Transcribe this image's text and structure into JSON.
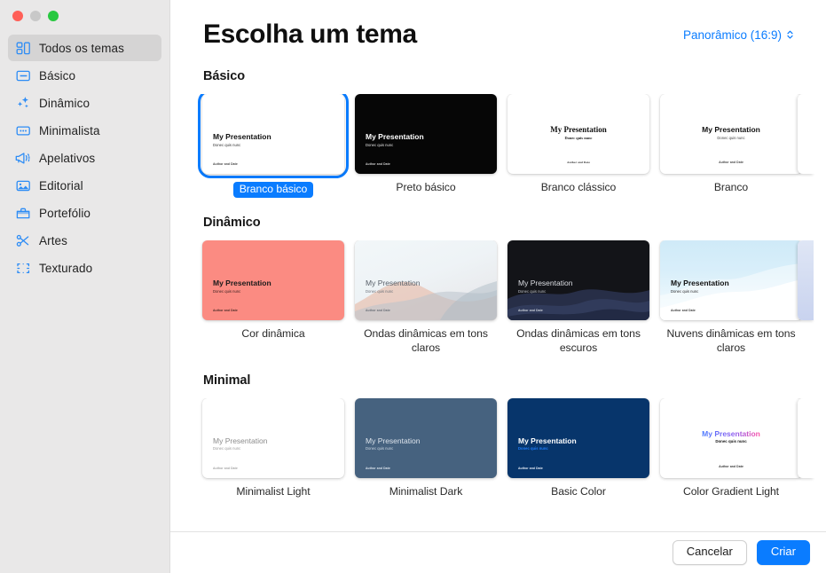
{
  "window": {
    "traffic_lights": [
      "close",
      "minimize",
      "zoom"
    ]
  },
  "sidebar": {
    "items": [
      {
        "label": "Todos os temas",
        "icon": "grid-icon",
        "selected": true
      },
      {
        "label": "Básico",
        "icon": "slide-icon",
        "selected": false
      },
      {
        "label": "Dinâmico",
        "icon": "sparkles-icon",
        "selected": false
      },
      {
        "label": "Minimalista",
        "icon": "caption-icon",
        "selected": false
      },
      {
        "label": "Apelativos",
        "icon": "megaphone-icon",
        "selected": false
      },
      {
        "label": "Editorial",
        "icon": "photo-icon",
        "selected": false
      },
      {
        "label": "Portefólio",
        "icon": "briefcase-icon",
        "selected": false
      },
      {
        "label": "Artes",
        "icon": "scissors-icon",
        "selected": false
      },
      {
        "label": "Texturado",
        "icon": "crop-icon",
        "selected": false
      }
    ]
  },
  "header": {
    "title": "Escolha um tema",
    "ratio_label": "Panorâmico (16:9)",
    "chevron_icon": "chevron-updown-icon"
  },
  "slide_text": {
    "title": "My Presentation",
    "subtitle": "Donec quis nunc",
    "footer": "Author and Date"
  },
  "sections": [
    {
      "title": "Básico",
      "themes": [
        {
          "name": "Branco básico",
          "selected": true
        },
        {
          "name": "Preto básico",
          "selected": false
        },
        {
          "name": "Branco clássico",
          "selected": false
        },
        {
          "name": "Branco",
          "selected": false
        }
      ]
    },
    {
      "title": "Dinâmico",
      "themes": [
        {
          "name": "Cor dinâmica",
          "selected": false
        },
        {
          "name": "Ondas dinâmicas em tons claros",
          "selected": false
        },
        {
          "name": "Ondas dinâmicas em tons escuros",
          "selected": false
        },
        {
          "name": "Nuvens dinâmicas em tons claros",
          "selected": false
        }
      ]
    },
    {
      "title": "Minimal",
      "themes": [
        {
          "name": "Minimalist Light",
          "selected": false
        },
        {
          "name": "Minimalist Dark",
          "selected": false
        },
        {
          "name": "Basic Color",
          "selected": false
        },
        {
          "name": "Color Gradient Light",
          "selected": false
        }
      ]
    }
  ],
  "footer": {
    "cancel_label": "Cancelar",
    "create_label": "Criar"
  },
  "colors": {
    "accent": "#0a7cff",
    "sidebar_bg": "#e9e8e8",
    "sidebar_selected_bg": "#d5d4d4",
    "dynamic_color": "#fb8b82",
    "minimalist_dark": "#46627f",
    "basic_color_navy": "#07356b",
    "basic_color_accent": "#1271ff",
    "gradient_from": "#4a7bff",
    "gradient_to": "#ff4fa3"
  }
}
